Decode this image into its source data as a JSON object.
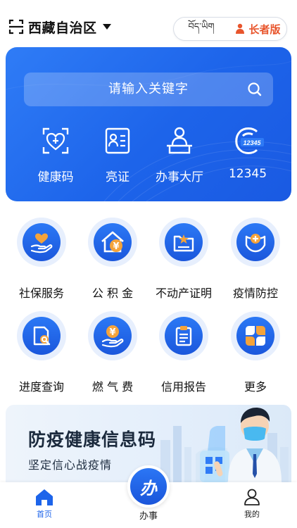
{
  "header": {
    "region_label": "西藏自治区",
    "tibetan_label": "བོད་ཡིག",
    "elder_mode_label": "长者版"
  },
  "hero": {
    "search_placeholder": "请输入关键字",
    "quick_actions": [
      {
        "label": "健康码",
        "icon": "health-code-icon"
      },
      {
        "label": "亮证",
        "icon": "id-card-icon"
      },
      {
        "label": "办事大厅",
        "icon": "service-hall-icon"
      },
      {
        "label": "12345",
        "icon": "hotline-12345-icon",
        "badge": "12345"
      }
    ]
  },
  "services": [
    {
      "label": "社保服务",
      "icon": "social-security-icon"
    },
    {
      "label": "公 积 金",
      "icon": "housing-fund-icon",
      "symbol": "¥"
    },
    {
      "label": "不动产证明",
      "icon": "property-certificate-icon"
    },
    {
      "label": "疫情防控",
      "icon": "epidemic-control-icon"
    },
    {
      "label": "进度查询",
      "icon": "progress-query-icon"
    },
    {
      "label": "燃 气 费",
      "icon": "gas-fee-icon",
      "symbol": "¥"
    },
    {
      "label": "信用报告",
      "icon": "credit-report-icon"
    },
    {
      "label": "更多",
      "icon": "more-icon"
    }
  ],
  "banner": {
    "title": "防疫健康信息码",
    "subtitle": "坚定信心战疫情"
  },
  "bottom_nav": {
    "home_label": "首页",
    "center_label": "办事",
    "center_glyph": "办",
    "me_label": "我的"
  },
  "colors": {
    "primary": "#1d64ea",
    "elder_accent": "#e8552c",
    "active_tab": "#1d64ea",
    "banner_text": "#1b2a3d"
  }
}
